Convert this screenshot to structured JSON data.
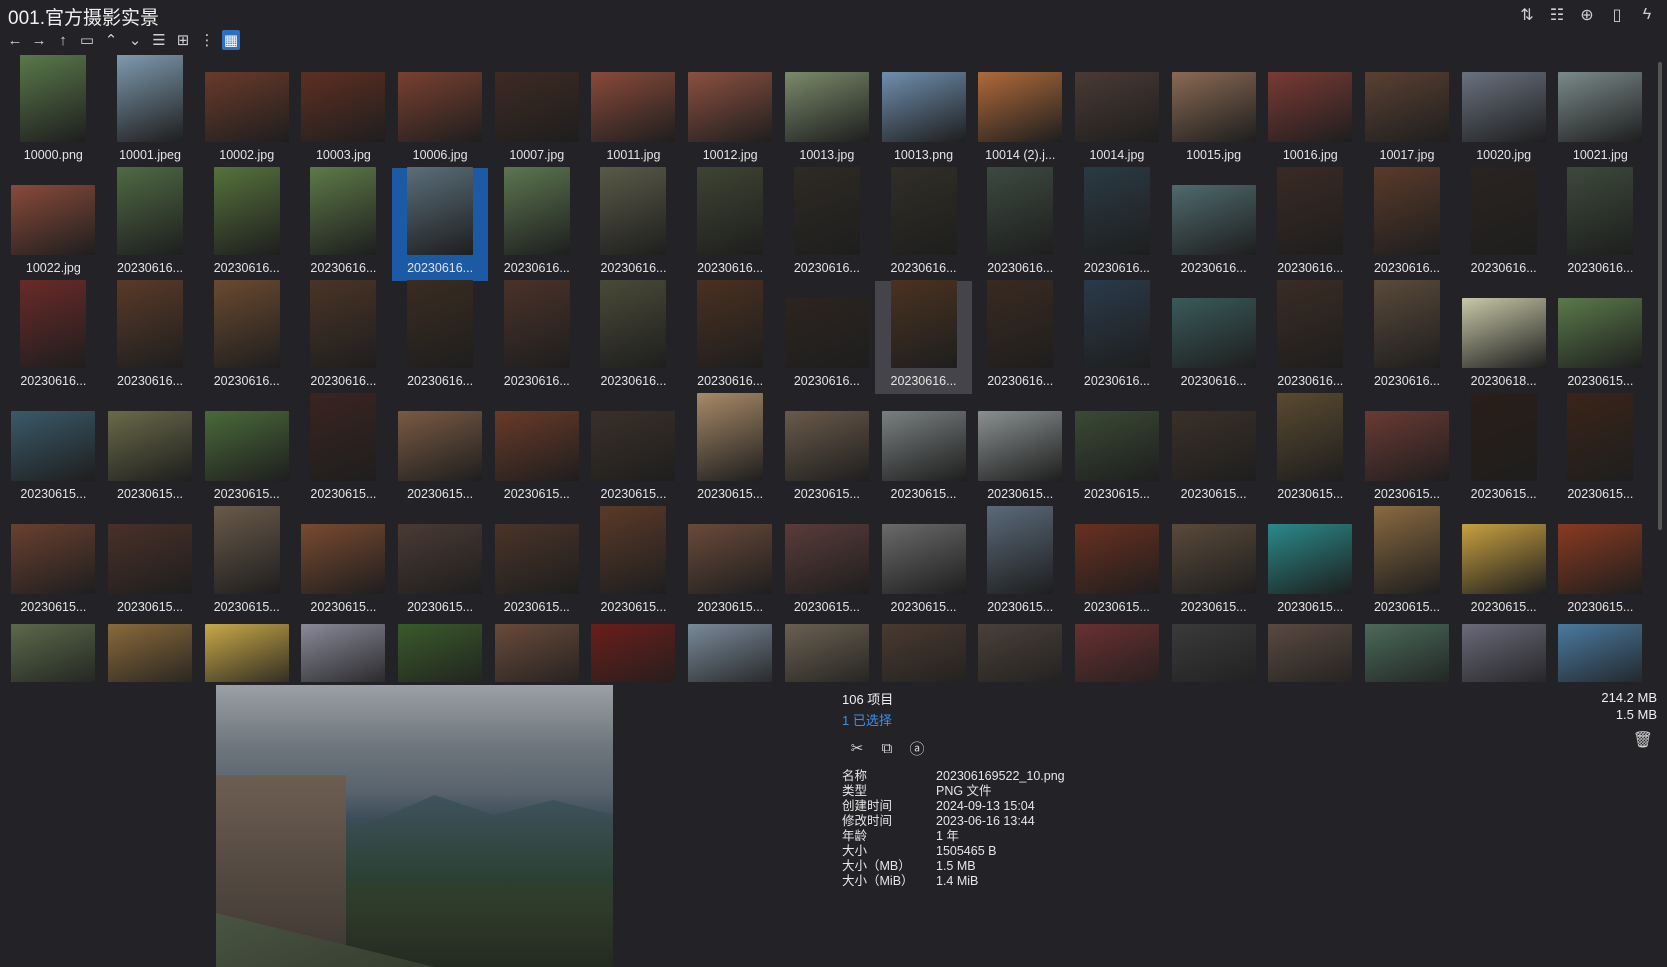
{
  "window": {
    "title": "001.官方摄影实景"
  },
  "top_icons": [
    "sort-icon",
    "list-view-icon",
    "add-icon",
    "clipboard-icon",
    "pin-icon"
  ],
  "toolbar": [
    {
      "name": "back-icon",
      "glyph": "←"
    },
    {
      "name": "forward-icon",
      "glyph": "→"
    },
    {
      "name": "up-icon",
      "glyph": "↑"
    },
    {
      "name": "folder-window-icon",
      "glyph": "▭"
    },
    {
      "name": "chevron-up-icon",
      "glyph": "⌃"
    },
    {
      "name": "chevron-down-icon",
      "glyph": "⌄"
    },
    {
      "name": "details-view-icon",
      "glyph": "☰"
    },
    {
      "name": "tiles-view-icon",
      "glyph": "⊞"
    },
    {
      "name": "tree-view-icon",
      "glyph": "⋮"
    },
    {
      "name": "thumbnail-view-icon",
      "glyph": "▦",
      "active": true
    }
  ],
  "files": [
    {
      "name": "10000.png",
      "c": "#5a7a4a",
      "tall": true
    },
    {
      "name": "10001.jpeg",
      "c": "#7f9bb0",
      "tall": true
    },
    {
      "name": "10002.jpg",
      "c": "#6a3a2a"
    },
    {
      "name": "10003.jpg",
      "c": "#5e2f22"
    },
    {
      "name": "10006.jpg",
      "c": "#7a4030"
    },
    {
      "name": "10007.jpg",
      "c": "#3e2a22"
    },
    {
      "name": "10011.jpg",
      "c": "#8a4a3a"
    },
    {
      "name": "10012.jpg",
      "c": "#8c5040"
    },
    {
      "name": "10013.jpg",
      "c": "#7a8a6a"
    },
    {
      "name": "10013.png",
      "c": "#6f8fae"
    },
    {
      "name": "10014 (2).j...",
      "c": "#b06a3a"
    },
    {
      "name": "10014.jpg",
      "c": "#4a3a34"
    },
    {
      "name": "10015.jpg",
      "c": "#8a6a54"
    },
    {
      "name": "10016.jpg",
      "c": "#7a3a34"
    },
    {
      "name": "10017.jpg",
      "c": "#5a4032"
    },
    {
      "name": "10020.jpg",
      "c": "#6a7280"
    },
    {
      "name": "10021.jpg",
      "c": "#7a8a8a"
    },
    {
      "name": "10022.jpg",
      "c": "#8a4a3a"
    },
    {
      "name": "20230616...",
      "c": "#4f6a44",
      "tall": true
    },
    {
      "name": "20230616...",
      "c": "#56723c",
      "tall": true
    },
    {
      "name": "20230616...",
      "c": "#5d7a48",
      "tall": true
    },
    {
      "name": "20230616...",
      "c": "#5a6e7a",
      "tall": true
    },
    {
      "name": "20230616...",
      "c": "#5c7650",
      "tall": true
    },
    {
      "name": "20230616...",
      "c": "#5a5a48",
      "tall": true
    },
    {
      "name": "20230616...",
      "c": "#3e4432",
      "tall": true
    },
    {
      "name": "20230616...",
      "c": "#2e2a24",
      "tall": true
    },
    {
      "name": "20230616...",
      "c": "#302e26",
      "tall": true
    },
    {
      "name": "20230616...",
      "c": "#3c4a40",
      "tall": true
    },
    {
      "name": "20230616...",
      "c": "#2a3a44",
      "tall": true
    },
    {
      "name": "20230616...",
      "c": "#4f6a6e"
    },
    {
      "name": "20230616...",
      "c": "#3a2a24",
      "tall": true
    },
    {
      "name": "20230616...",
      "c": "#5a3a2a",
      "tall": true
    },
    {
      "name": "20230616...",
      "c": "#2a2420",
      "tall": true
    },
    {
      "name": "20230616...",
      "c": "#3c4a3a",
      "tall": true
    },
    {
      "name": "20230616...",
      "c": "#6a2a28",
      "tall": true
    },
    {
      "name": "20230616...",
      "c": "#5a3a28",
      "tall": true
    },
    {
      "name": "20230616...",
      "c": "#6a4a30",
      "tall": true
    },
    {
      "name": "20230616...",
      "c": "#4a3426",
      "tall": true
    },
    {
      "name": "20230616...",
      "c": "#3a2c20",
      "tall": true
    },
    {
      "name": "20230616...",
      "c": "#4a3228",
      "tall": true
    },
    {
      "name": "20230616...",
      "c": "#4a4a38",
      "tall": true
    },
    {
      "name": "20230616...",
      "c": "#4a3020",
      "tall": true
    },
    {
      "name": "20230616...",
      "c": "#2c2420"
    },
    {
      "name": "20230616...",
      "c": "#4a3220",
      "tall": true
    },
    {
      "name": "20230616...",
      "c": "#3a2a20",
      "tall": true
    },
    {
      "name": "20230616...",
      "c": "#2a3a4a",
      "tall": true
    },
    {
      "name": "20230616...",
      "c": "#3a5a5a"
    },
    {
      "name": "20230616...",
      "c": "#3a2c24",
      "tall": true
    },
    {
      "name": "20230616...",
      "c": "#5a4a3a",
      "tall": true
    },
    {
      "name": "20230618...",
      "c": "#c8c8a8"
    },
    {
      "name": "20230615...",
      "c": "#5a7a4a"
    },
    {
      "name": "20230615...",
      "c": "#3a5a6a"
    },
    {
      "name": "20230615...",
      "c": "#6a6a4a"
    },
    {
      "name": "20230615...",
      "c": "#4a6a3a"
    },
    {
      "name": "20230615...",
      "c": "#3a2420",
      "tall": true
    },
    {
      "name": "20230615...",
      "c": "#7a5a44"
    },
    {
      "name": "20230615...",
      "c": "#6a3a28"
    },
    {
      "name": "20230615...",
      "c": "#3a3028"
    },
    {
      "name": "20230615...",
      "c": "#a88a68",
      "tall": true
    },
    {
      "name": "20230615...",
      "c": "#6a5a4a"
    },
    {
      "name": "20230615...",
      "c": "#7a8080"
    },
    {
      "name": "20230615...",
      "c": "#8a9090"
    },
    {
      "name": "20230615...",
      "c": "#3a4a34"
    },
    {
      "name": "20230615...",
      "c": "#3a3028"
    },
    {
      "name": "20230615...",
      "c": "#5a4a30",
      "tall": true
    },
    {
      "name": "20230615...",
      "c": "#6a3a34"
    },
    {
      "name": "20230615...",
      "c": "#2a1e18",
      "tall": true
    },
    {
      "name": "20230615...",
      "c": "#3a2418",
      "tall": true
    },
    {
      "name": "20230615...",
      "c": "#6a4030"
    },
    {
      "name": "20230615...",
      "c": "#4a3028"
    },
    {
      "name": "20230615...",
      "c": "#6a5a4a",
      "tall": true
    },
    {
      "name": "20230615...",
      "c": "#7a4a30"
    },
    {
      "name": "20230615...",
      "c": "#4a3a34"
    },
    {
      "name": "20230615...",
      "c": "#4a3428"
    },
    {
      "name": "20230615...",
      "c": "#5a3a28",
      "tall": true
    },
    {
      "name": "20230615...",
      "c": "#6a4a3a"
    },
    {
      "name": "20230615...",
      "c": "#5a3c3a"
    },
    {
      "name": "20230615...",
      "c": "#6a6a6a"
    },
    {
      "name": "20230615...",
      "c": "#5a6a7a",
      "tall": true
    },
    {
      "name": "20230615...",
      "c": "#6a3020"
    },
    {
      "name": "20230615...",
      "c": "#5a4a3a"
    },
    {
      "name": "20230615...",
      "c": "#2a8a8a"
    },
    {
      "name": "20230615...",
      "c": "#8a6a40",
      "tall": true
    },
    {
      "name": "20230615...",
      "c": "#c8a040"
    },
    {
      "name": "20230615...",
      "c": "#8a3a20"
    }
  ],
  "partial_row": [
    "#5a6a4a",
    "#8a6a3a",
    "#c8a848",
    "#8a8a9a",
    "#3a5a2a",
    "#6a4a3a",
    "#6a1e1a",
    "#7a8a9a",
    "#6a6050",
    "#4a3a30",
    "#4a4038",
    "#6a3030",
    "#3a3a3a",
    "#5a4a40",
    "#4a6a5a",
    "#6a6a7a",
    "#4a7aa0"
  ],
  "info": {
    "items_count": "106 项目",
    "selected_count": "1 已选择",
    "total_size": "214.2 MB",
    "selected_size": "1.5 MB",
    "properties": [
      {
        "k": "名称",
        "v": "202306169522_10.png"
      },
      {
        "k": "类型",
        "v": "PNG 文件"
      },
      {
        "k": "创建时间",
        "v": "2024-09-13  15:04"
      },
      {
        "k": "修改时间",
        "v": "2023-06-16  13:44"
      },
      {
        "k": "年龄",
        "v": "1 年"
      },
      {
        "k": "大小",
        "v": "1505465 B"
      },
      {
        "k": "大小（MB）",
        "v": "1.5 MB"
      },
      {
        "k": "大小（MiB）",
        "v": "1.4 MiB"
      }
    ]
  },
  "selection": {
    "selected_index": 21,
    "hover_index": 43
  }
}
